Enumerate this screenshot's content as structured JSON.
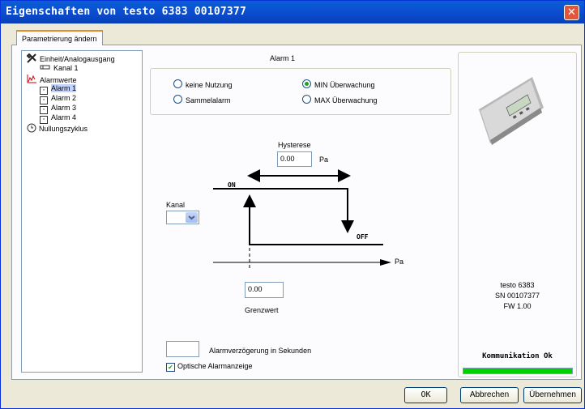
{
  "window": {
    "title": "Eigenschaften von testo 6383  00107377",
    "close_glyph": "✕"
  },
  "tab": {
    "label": "Parametrierung ändern"
  },
  "tree": {
    "items": [
      {
        "label": "Einheit/Analogausgang",
        "icon": "tools-icon"
      },
      {
        "label": "Kanal 1",
        "icon": "channel-icon"
      },
      {
        "label": "Alarmwerte",
        "icon": "chart-icon"
      },
      {
        "label": "Alarm 1",
        "icon": "checkbox-icon",
        "selected": true
      },
      {
        "label": "Alarm 2",
        "icon": "checkbox-icon"
      },
      {
        "label": "Alarm 3",
        "icon": "checkbox-icon"
      },
      {
        "label": "Alarm 4",
        "icon": "checkbox-icon"
      },
      {
        "label": "Nullungszyklus",
        "icon": "clock-icon"
      }
    ]
  },
  "alarm": {
    "group_title": "Alarm 1",
    "options": {
      "none": "keine Nutzung",
      "min": "MIN Überwachung",
      "collective": "Sammelalarm",
      "max": "MAX Überwachung",
      "selected": "min"
    },
    "hysteresis_label": "Hysterese",
    "hysteresis_value": "0.00",
    "hysteresis_unit": "Pa",
    "on_label": "ON",
    "off_label": "OFF",
    "axis_unit": "Pa",
    "channel_label": "Kanal",
    "channel_value": "",
    "limit_value": "0.00",
    "limit_label": "Grenzwert",
    "delay_value": "",
    "delay_label": "Alarmverzögerung in Sekunden",
    "optical_label": "Optische Alarmanzeige",
    "optical_checked": true,
    "check_glyph": "✔"
  },
  "device": {
    "model": "testo 6383",
    "serial": "SN 00107377",
    "firmware": "FW  1.00",
    "status": "Kommunikation Ok",
    "status_color": "#00d000"
  },
  "buttons": {
    "ok": "OK",
    "cancel": "Abbrechen",
    "apply": "Übernehmen"
  }
}
